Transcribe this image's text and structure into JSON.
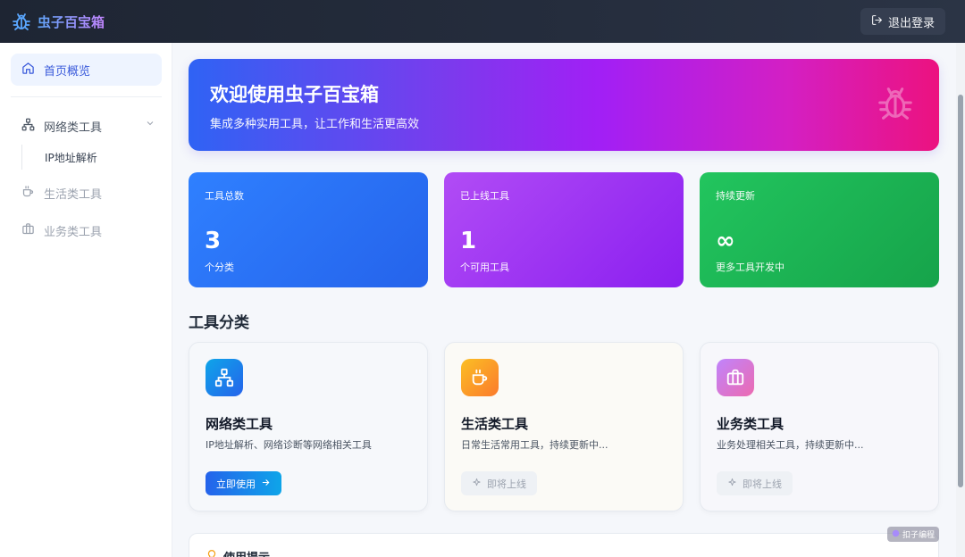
{
  "header": {
    "brand_title": "虫子百宝箱",
    "logout_label": "退出登录"
  },
  "sidebar": {
    "home_label": "首页概览",
    "groups": [
      {
        "label": "网络类工具",
        "icon": "network-icon",
        "expanded": true,
        "children": [
          {
            "label": "IP地址解析"
          }
        ]
      },
      {
        "label": "生活类工具",
        "icon": "cup-icon"
      },
      {
        "label": "业务类工具",
        "icon": "briefcase-icon"
      }
    ]
  },
  "banner": {
    "title": "欢迎使用虫子百宝箱",
    "subtitle": "集成多种实用工具，让工作和生活更高效"
  },
  "stats": [
    {
      "label": "工具总数",
      "value": "3",
      "sub": "个分类",
      "color": "#2563eb"
    },
    {
      "label": "已上线工具",
      "value": "1",
      "sub": "个可用工具",
      "color": "#8b1ff0"
    },
    {
      "label": "持续更新",
      "value": "∞",
      "sub": "更多工具开发中",
      "color": "#16a34a"
    }
  ],
  "section_title": "工具分类",
  "categories": [
    {
      "title": "网络类工具",
      "desc": "IP地址解析、网络诊断等网络相关工具",
      "button": "立即使用",
      "icon": "network-icon",
      "color": "#0ea5e9"
    },
    {
      "title": "生活类工具",
      "desc": "日常生活常用工具，持续更新中...",
      "button": "即将上线",
      "icon": "cup-icon",
      "color": "#fb8c2c"
    },
    {
      "title": "业务类工具",
      "desc": "业务处理相关工具，持续更新中...",
      "button": "即将上线",
      "icon": "briefcase-icon",
      "color": "#d66ad8"
    }
  ],
  "tip": {
    "title": "使用提示"
  },
  "watermark": "扣子编程"
}
